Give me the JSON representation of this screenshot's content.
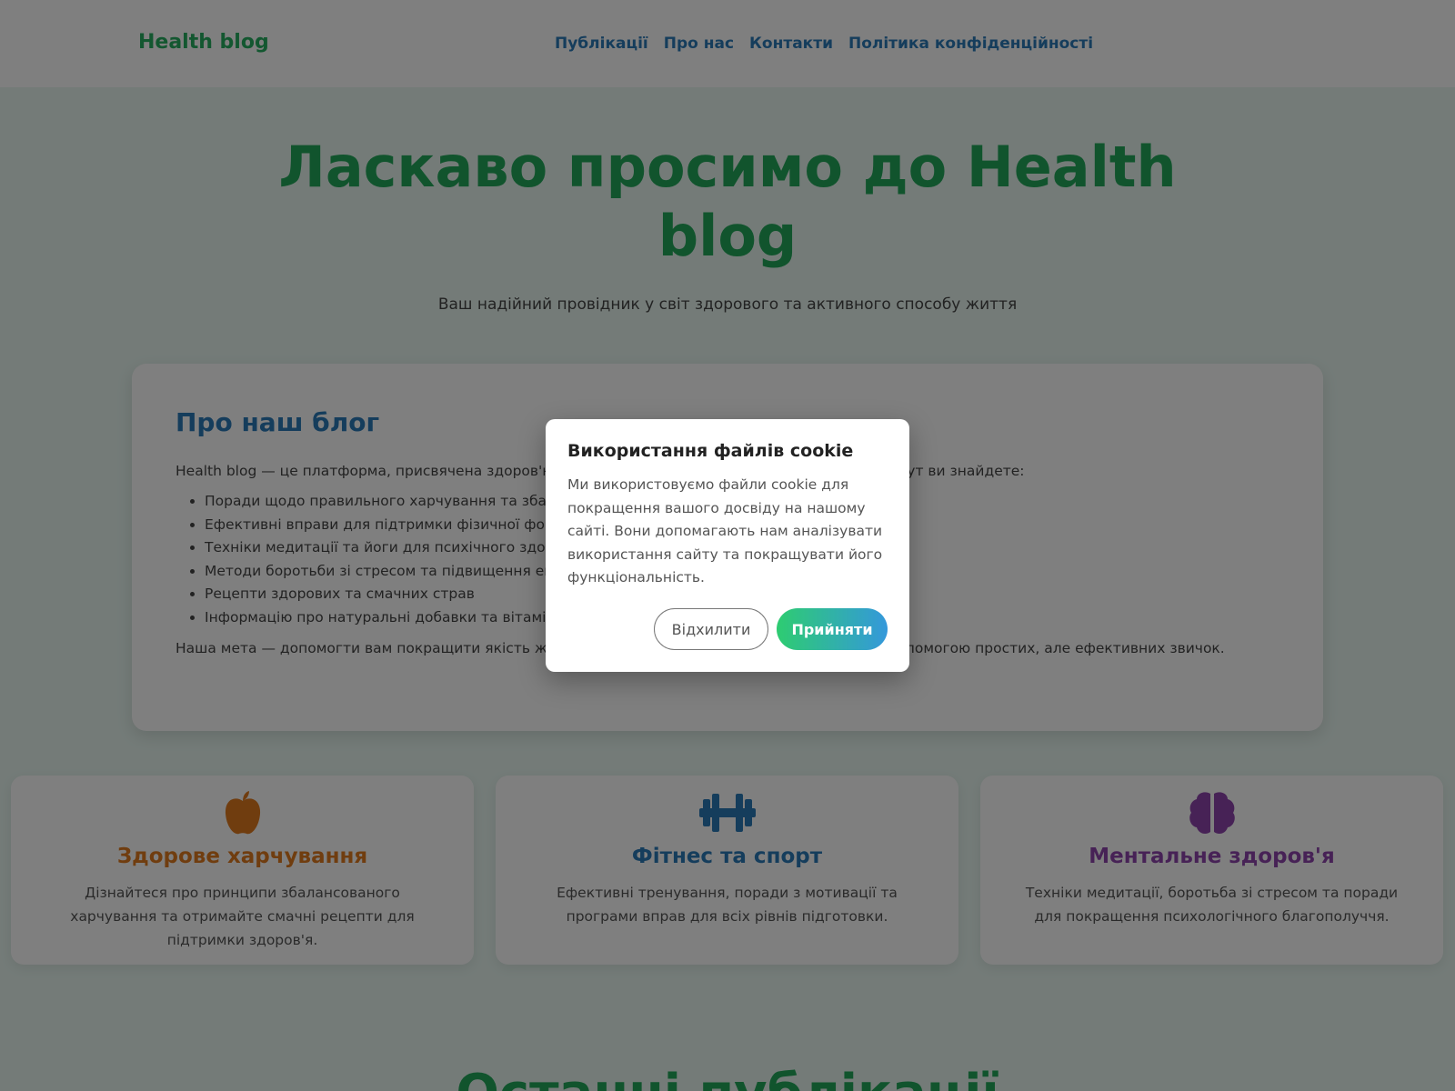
{
  "header": {
    "logo": "Health blog",
    "nav": [
      "Публікації",
      "Про нас",
      "Контакти",
      "Політика конфіденційності"
    ]
  },
  "hero": {
    "title": "Ласкаво просимо до Health blog",
    "subtitle": "Ваш надійний провідник у світ здорового та активного способу життя"
  },
  "about": {
    "heading": "Про наш блог",
    "intro": "Health blog — це платформа, присвячена здоров'ю, благополуччю та активному способу життя. Тут ви знайдете:",
    "items": [
      "Поради щодо правильного харчування та збалансованого раціону",
      "Ефективні вправи для підтримки фізичної форми",
      "Техніки медитації та йоги для психічного здоров'я",
      "Методи боротьби зі стресом та підвищення енергії",
      "Рецепти здорових та смачних страв",
      "Інформацію про натуральні добавки та вітаміни"
    ],
    "outro": "Наша мета — допомогти вам покращити якість життя, стати здоровішими та щасливішими за допомогою простих, але ефективних звичок."
  },
  "features": [
    {
      "icon": "apple-icon",
      "title": "Здорове харчування",
      "text": "Дізнайтеся про принципи збалансованого харчування та отримайте смачні рецепти для підтримки здоров'я."
    },
    {
      "icon": "dumbbell-icon",
      "title": "Фітнес та спорт",
      "text": "Ефективні тренування, поради з мотивації та програми вправ для всіх рівнів підготовки."
    },
    {
      "icon": "brain-icon",
      "title": "Ментальне здоров'я",
      "text": "Техніки медитації, боротьба зі стресом та поради для покращення психологічного благополуччя."
    }
  ],
  "latest_title": "Останні публікації",
  "cookie": {
    "title": "Використання файлів cookie",
    "text": "Ми використовуємо файли cookie для покращення вашого досвіду на нашому сайті. Вони допомагають нам аналізувати використання сайту та покращувати його функціональність.",
    "decline": "Відхилити",
    "accept": "Прийняти"
  },
  "colors": {
    "brand_green": "#22a85a",
    "brand_blue": "#2b7bb9",
    "orange": "#e07b1f",
    "purple": "#8e44ad"
  }
}
